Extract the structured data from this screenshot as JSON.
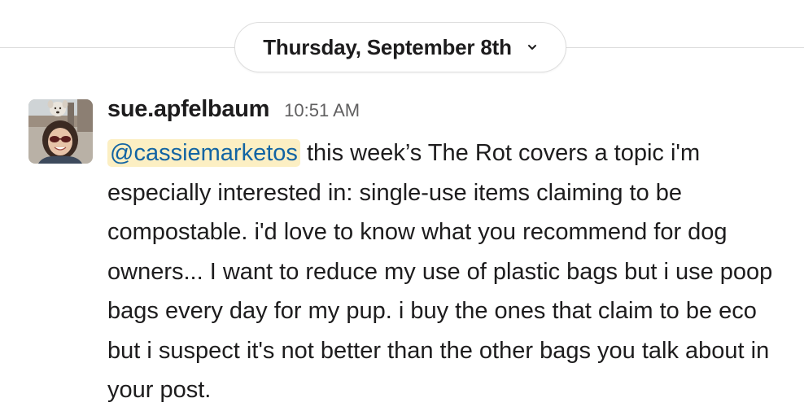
{
  "date_divider": {
    "label": "Thursday, September 8th"
  },
  "message": {
    "author": "sue.apfelbaum",
    "time": "10:51 AM",
    "mention": "@cassiemarketos",
    "text": "this week’s The Rot covers a topic i'm especially interested in: single-use items claiming to be compostable. i'd love to know what you recommend for dog owners... I want to reduce my use of plastic bags but i use poop bags every day for my pup. i buy the ones that claim to be eco but i suspect it's not better than the other bags you talk about in your post."
  },
  "icons": {
    "date_dropdown": "chevron-down-icon",
    "avatar": "user-avatar"
  },
  "colors": {
    "mention_bg": "#fcefc3",
    "mention_text": "#1264a3",
    "timestamp": "#616061"
  }
}
